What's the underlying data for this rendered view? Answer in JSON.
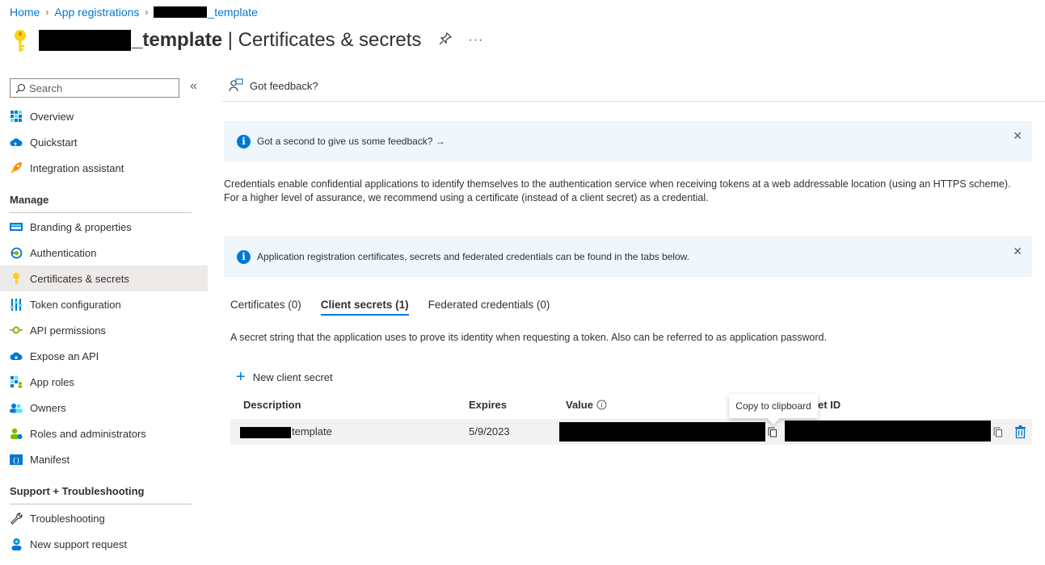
{
  "breadcrumb": {
    "home": "Home",
    "app_registrations": "App registrations",
    "app_suffix": "_template"
  },
  "title": {
    "app_suffix": "_template",
    "separator": " | ",
    "page": "Certificates & secrets"
  },
  "sidebar": {
    "search_placeholder": "Search",
    "collapse_icon": "«",
    "items_top": [
      {
        "label": "Overview",
        "icon": "grid-icon"
      },
      {
        "label": "Quickstart",
        "icon": "cloud-icon"
      },
      {
        "label": "Integration assistant",
        "icon": "rocket-icon"
      }
    ],
    "manage_header": "Manage",
    "manage_items": [
      {
        "label": "Branding & properties",
        "icon": "branding-icon"
      },
      {
        "label": "Authentication",
        "icon": "auth-icon"
      },
      {
        "label": "Certificates & secrets",
        "icon": "key-icon"
      },
      {
        "label": "Token configuration",
        "icon": "token-icon"
      },
      {
        "label": "API permissions",
        "icon": "permissions-icon"
      },
      {
        "label": "Expose an API",
        "icon": "cloud-icon"
      },
      {
        "label": "App roles",
        "icon": "roles-icon"
      },
      {
        "label": "Owners",
        "icon": "owners-icon"
      },
      {
        "label": "Roles and administrators",
        "icon": "admin-icon"
      },
      {
        "label": "Manifest",
        "icon": "manifest-icon"
      }
    ],
    "support_header": "Support + Troubleshooting",
    "support_items": [
      {
        "label": "Troubleshooting",
        "icon": "wrench-icon"
      },
      {
        "label": "New support request",
        "icon": "support-icon"
      }
    ]
  },
  "main": {
    "feedback_label": "Got feedback?",
    "banner1_text": "Got a second to give us some feedback? →",
    "description": "Credentials enable confidential applications to identify themselves to the authentication service when receiving tokens at a web addressable location (using an HTTPS scheme). For a higher level of assurance, we recommend using a certificate (instead of a client secret) as a credential.",
    "banner2_text": "Application registration certificates, secrets and federated credentials can be found in the tabs below.",
    "tabs": [
      {
        "label": "Certificates (0)"
      },
      {
        "label": "Client secrets (1)"
      },
      {
        "label": "Federated credentials (0)"
      }
    ],
    "active_tab": "Client secrets (1)",
    "secret_description": "A secret string that the application uses to prove its identity when requesting a token. Also can be referred to as application password.",
    "new_secret_label": "New client secret",
    "table": {
      "headers": {
        "description": "Description",
        "expires": "Expires",
        "value": "Value",
        "secret_id": "et ID"
      },
      "rows": [
        {
          "description_suffix": "template",
          "expires": "5/9/2023"
        }
      ]
    },
    "tooltip": "Copy to clipboard"
  },
  "colors": {
    "accent": "#0078d4",
    "banner_bg": "#eff6fc",
    "active_nav": "#edebe9",
    "row_bg": "#f3f2f1"
  }
}
